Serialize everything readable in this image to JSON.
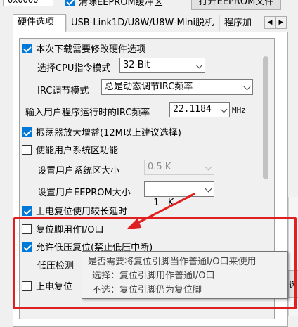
{
  "top": {
    "address_value": "0x0000",
    "clear_eeprom_label": "清除EEPROM缓冲区",
    "open_eeprom_button": "打开EEPROM文件"
  },
  "tabs": [
    {
      "label": "硬件选项"
    },
    {
      "label": "USB-Link1D/U8W/U8W-Mini脱机"
    },
    {
      "label": "程序加"
    }
  ],
  "tab_scroll": {
    "left": "◀",
    "right": "▶"
  },
  "options": {
    "modify_hw_label": "本次下载需要修改硬件选项",
    "cpu_mode_label": "选择CPU指令模式",
    "cpu_mode_value": "32-Bit",
    "irc_mode_label": "IRC调节模式",
    "irc_mode_value": "总是动态调节IRC频率",
    "irc_freq_label": "输入用户程序运行时的IRC频率",
    "irc_freq_value": "22.1184",
    "irc_freq_unit": "MHz",
    "osc_gain_label": "振荡器放大增益(12M以上建议选择)",
    "sys_area_label": "使能用户系统区功能",
    "sys_area_size_label": "设置用户系统区大小",
    "sys_area_size_value": "0.5 K",
    "eeprom_size_label": "设置用户EEPROM大小",
    "eeprom_size_value": "1   K",
    "power_on_delay_label": "上电复位使用较长延时",
    "reset_pin_io_label": "复位脚用作I/O口",
    "lvr_label": "允许低压复位(禁止低压中断)",
    "lvr_threshold_label": "低压检测",
    "power_on_reset2_label": "上电复位"
  },
  "tooltip": {
    "line1": "是否需要将复位引脚当作普通I/O口来使用",
    "line2": "选择：复位引脚用作普通I/O口",
    "line3": "不选：复位引脚仍为复位脚"
  },
  "side": {
    "button_text": "选"
  },
  "colors": {
    "accent": "#0078d7",
    "highlight": "#e02020"
  }
}
